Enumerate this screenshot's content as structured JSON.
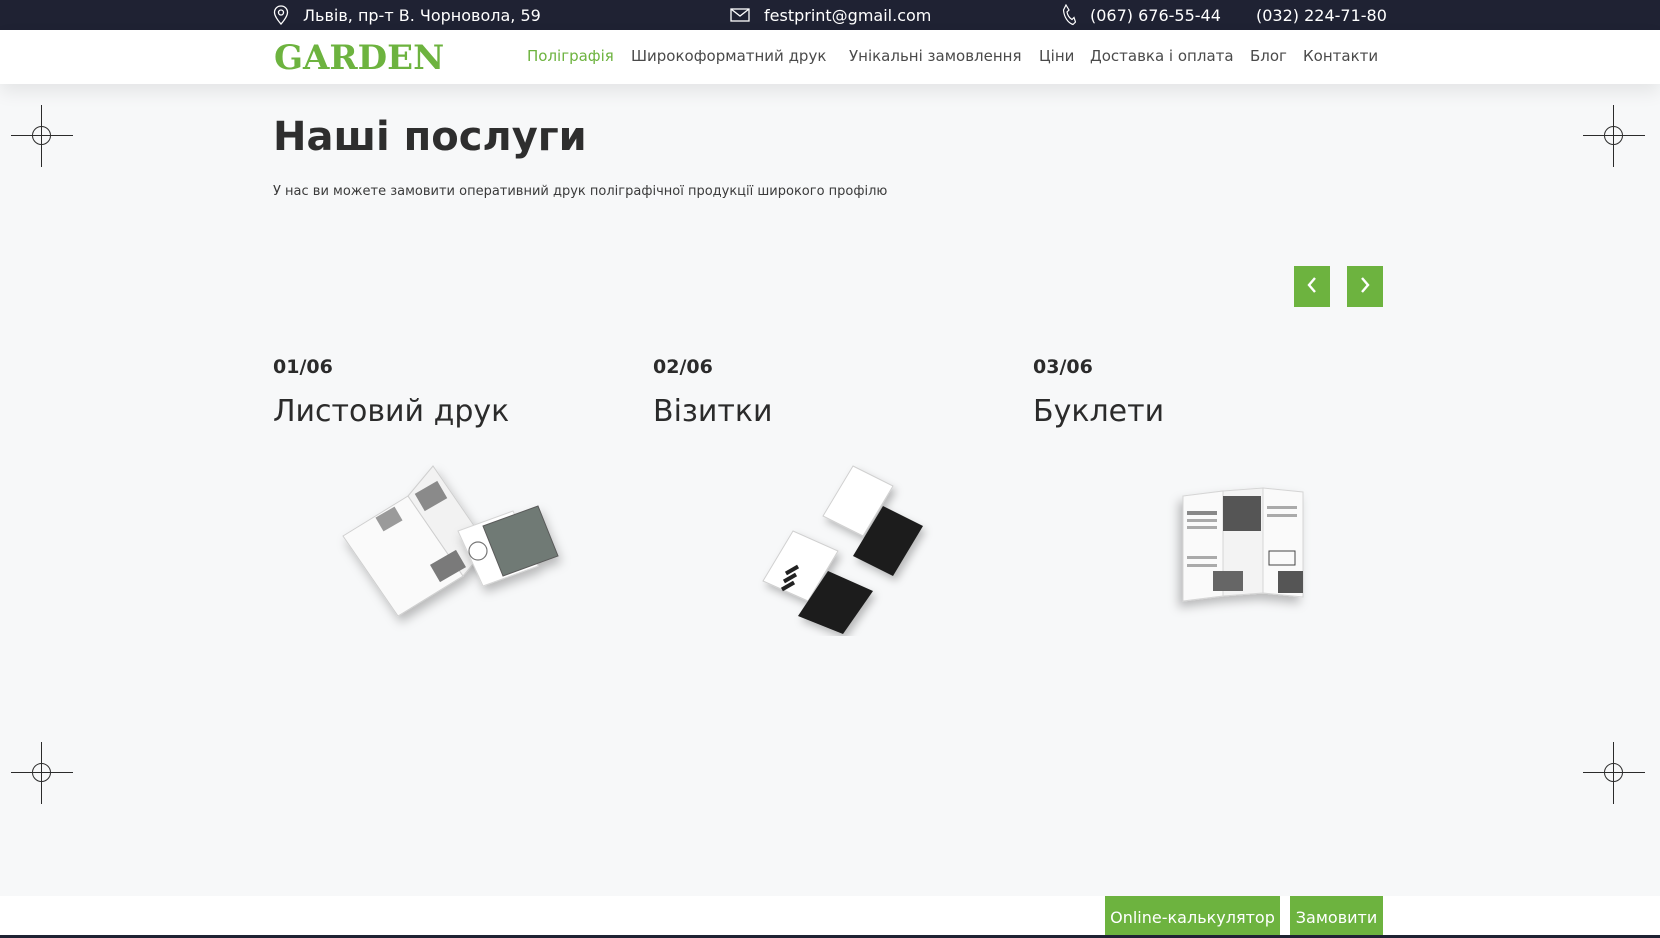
{
  "topbar": {
    "address": "Львів, пр-т В. Чорновола, 59",
    "email": "festprint@gmail.com",
    "phone1": "(067) 676-55-44",
    "phone2": "(032) 224-71-80"
  },
  "brand": {
    "logo": "GARDEN"
  },
  "nav": [
    {
      "label": "Поліграфія",
      "active": true
    },
    {
      "label": "Широкоформатний друк",
      "active": false
    },
    {
      "label": "Унікальні замовлення",
      "active": false
    },
    {
      "label": "Ціни",
      "active": false
    },
    {
      "label": "Доставка і оплата",
      "active": false
    },
    {
      "label": "Блог",
      "active": false
    },
    {
      "label": "Контакти",
      "active": false
    }
  ],
  "section": {
    "title": "Наші послуги",
    "subtitle": "У нас ви можете замовити оперативний друк поліграфічної продукції широкого профілю"
  },
  "services": [
    {
      "number": "01/06",
      "name": "Листовий друк",
      "image_icon": "open-brochure-image"
    },
    {
      "number": "02/06",
      "name": "Візитки",
      "image_icon": "business-cards-image"
    },
    {
      "number": "03/06",
      "name": "Буклети",
      "image_icon": "trifold-booklet-image"
    }
  ],
  "actions": {
    "calculator": "Online-калькулятор",
    "order": "Замовити"
  },
  "colors": {
    "accent": "#6db33f",
    "topbar_bg": "#1f2233",
    "page_bg": "#f7f8f9"
  }
}
